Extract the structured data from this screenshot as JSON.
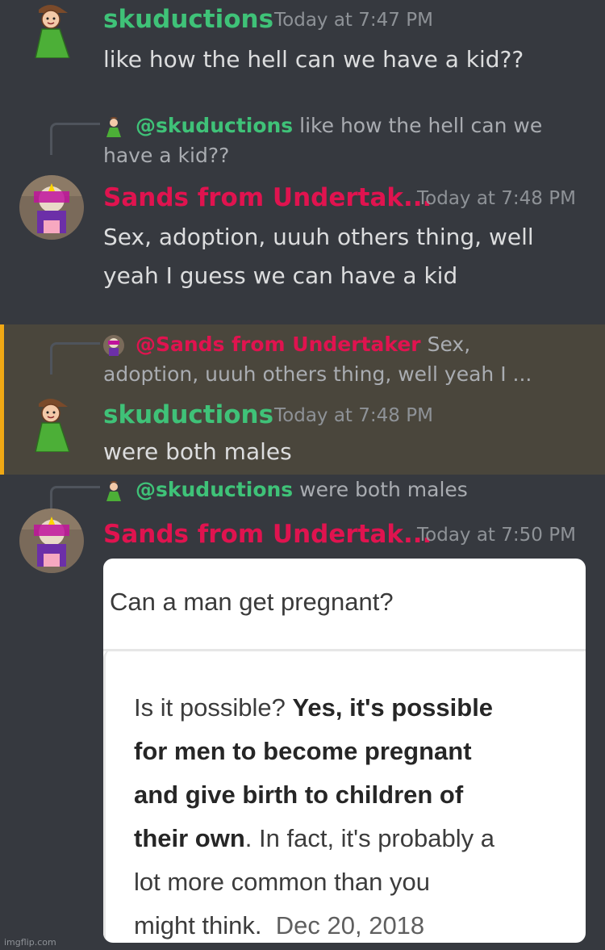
{
  "messages": [
    {
      "author": "skuductions",
      "timestamp": "Today at 7:47 PM",
      "text": "like how the hell can we have a kid??"
    },
    {
      "reply_to": {
        "mention": "@skuductions",
        "line1": "like how the hell can we",
        "line2": "have a kid??"
      },
      "author": "Sands from Undertak...",
      "timestamp": "Today at 7:48 PM",
      "line1": "Sex, adoption, uuuh others thing, well",
      "line2": "yeah I guess we can have a kid"
    },
    {
      "reply_to": {
        "mention": "@Sands from Undertaker",
        "line1": "Sex,",
        "line2": "adoption, uuuh others thing, well yeah I ..."
      },
      "author": "skuductions",
      "timestamp": "Today at 7:48 PM",
      "text": "were both males"
    },
    {
      "reply_to": {
        "mention": "@skuductions",
        "line1": "were both males"
      },
      "author": "Sands from Undertak...",
      "timestamp": "Today at 7:50 PM",
      "embed": {
        "question": "Can a man get pregnant?",
        "answer_lead": "Is it possible?",
        "answer_bold_1": "Yes, it's possible",
        "answer_bold_2": "for men to become pregnant",
        "answer_bold_3": "and give birth to children of",
        "answer_bold_4": "their own",
        "answer_tail_1": ". In fact, it's probably a",
        "answer_tail_2": "lot more common than you",
        "answer_tail_3": "might think.",
        "date": "Dec 20, 2018"
      }
    }
  ],
  "watermark": "imgflip.com",
  "colors": {
    "background": "#36393f",
    "green_name": "#3fc278",
    "red_name": "#e0134f",
    "highlight_bg": "#4a463c",
    "highlight_bar": "#f0a814"
  }
}
